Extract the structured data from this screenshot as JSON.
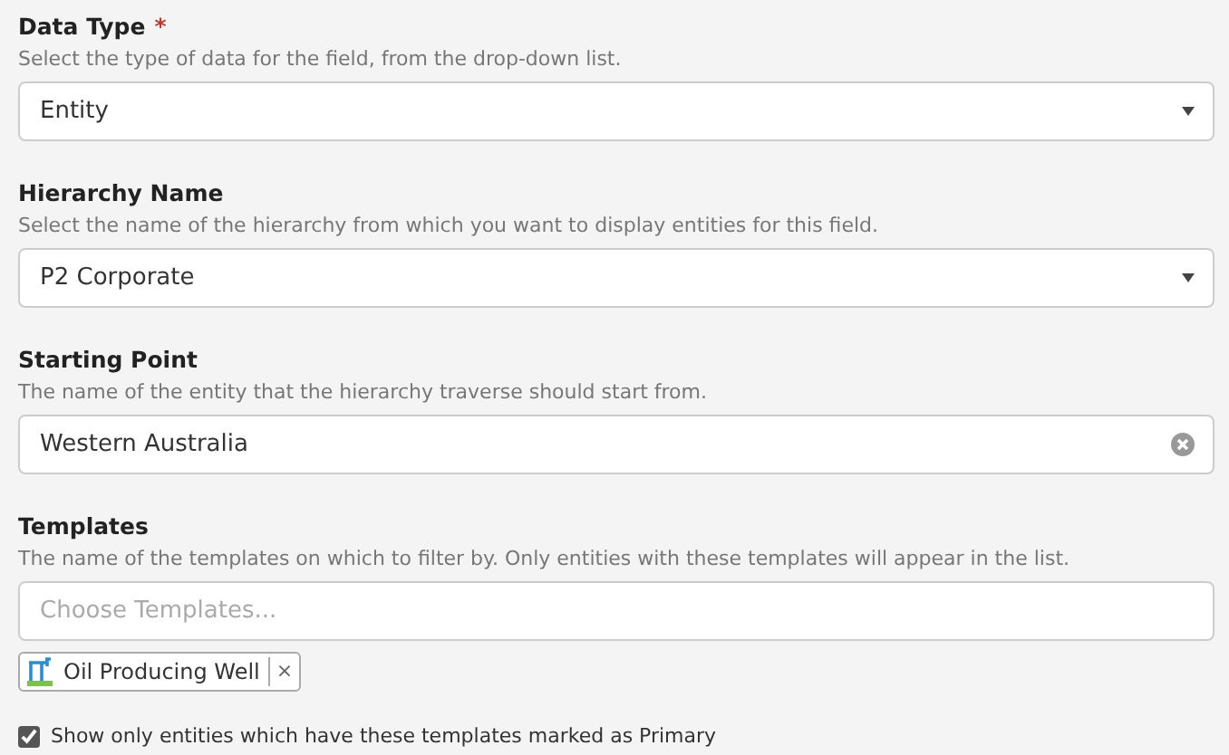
{
  "fields": [
    {
      "kind": "select",
      "label": "Data Type",
      "required_mark": "*",
      "description": "Select the type of data for the field, from the drop-down list.",
      "value": "Entity"
    },
    {
      "kind": "select",
      "label": "Hierarchy Name",
      "description": "Select the name of the hierarchy from which you want to display entities for this field.",
      "value": "P2 Corporate"
    },
    {
      "kind": "clearable",
      "label": "Starting Point",
      "description": "The name of the entity that the hierarchy traverse should start from.",
      "value": "Western Australia"
    },
    {
      "kind": "multiselect",
      "label": "Templates",
      "description": "The name of the templates on which to filter by. Only entities with these templates will appear in the list.",
      "placeholder": "Choose Templates...",
      "tags": [
        {
          "label": "Oil Producing Well",
          "remove": "×"
        }
      ]
    }
  ],
  "primary_checkbox": {
    "label": "Show only entities which have these templates marked as Primary",
    "checked": true
  }
}
